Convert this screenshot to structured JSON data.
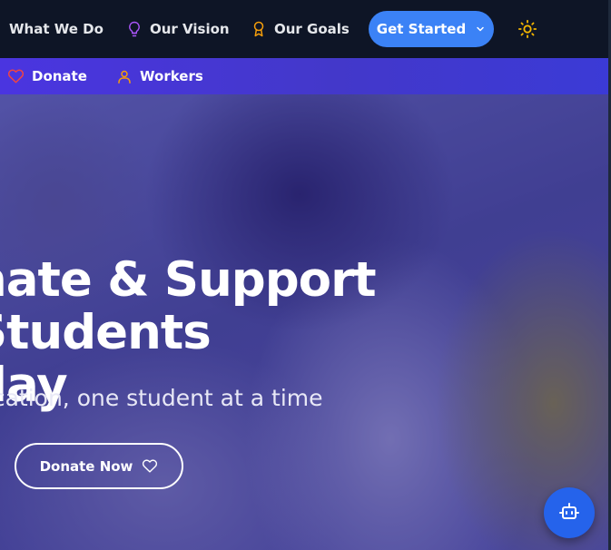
{
  "header": {
    "nav": [
      {
        "label": "What We Do",
        "icon": "none"
      },
      {
        "label": "Our Vision",
        "icon": "lightbulb-icon"
      },
      {
        "label": "Our Goals",
        "icon": "award-icon"
      }
    ],
    "cta_label": "Get Started",
    "theme_toggle_icon": "sun-icon"
  },
  "subnav": {
    "items": [
      {
        "label": "Donate",
        "icon": "heart-icon"
      },
      {
        "label": "Workers",
        "icon": "user-icon"
      }
    ]
  },
  "hero": {
    "title": "nate & Support Students\nday",
    "subtitle": "ucation, one student at a time",
    "button_label": "Donate Now",
    "button_icon": "heart-icon"
  },
  "chatbot": {
    "icon": "bot-icon"
  },
  "colors": {
    "topbar_bg": "#0e1526",
    "accent": "#3b82f6",
    "subnav_bg": "#4338ca",
    "vision_icon": "#a855f7",
    "goals_icon": "#f59e0b",
    "donate_icon": "#ef4444",
    "workers_icon": "#f59e0b",
    "sun_icon": "#f5b700"
  }
}
